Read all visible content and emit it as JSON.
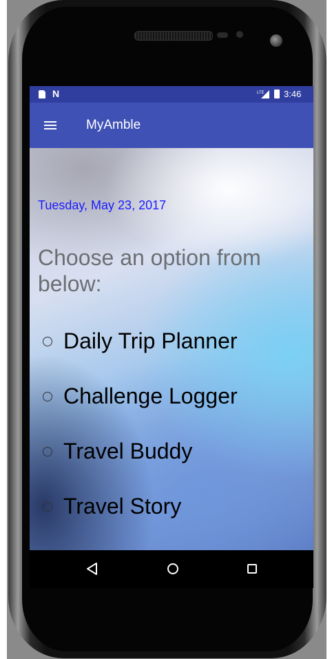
{
  "status_bar": {
    "sd_icon": "sd-card-icon",
    "n_label": "N",
    "signal_label": "LTE",
    "battery_icon": "battery-icon",
    "time": "3:46"
  },
  "toolbar": {
    "menu_icon": "hamburger-menu-icon",
    "title": "MyAmble",
    "color": "#3f51b5"
  },
  "main": {
    "date": "Tuesday, May 23, 2017",
    "prompt": "Choose an option from below:",
    "options": [
      {
        "label": "Daily Trip Planner",
        "selected": false
      },
      {
        "label": "Challenge Logger",
        "selected": false
      },
      {
        "label": "Travel Buddy",
        "selected": false
      },
      {
        "label": "Travel Story",
        "selected": false
      }
    ]
  },
  "nav_bar": {
    "back_icon": "back-triangle-icon",
    "home_icon": "home-circle-icon",
    "recents_icon": "recents-square-icon"
  },
  "colors": {
    "status_bar": "#303f9f",
    "toolbar": "#3f51b5",
    "date_text": "#1a1aff",
    "prompt_text": "#6b6f74"
  }
}
